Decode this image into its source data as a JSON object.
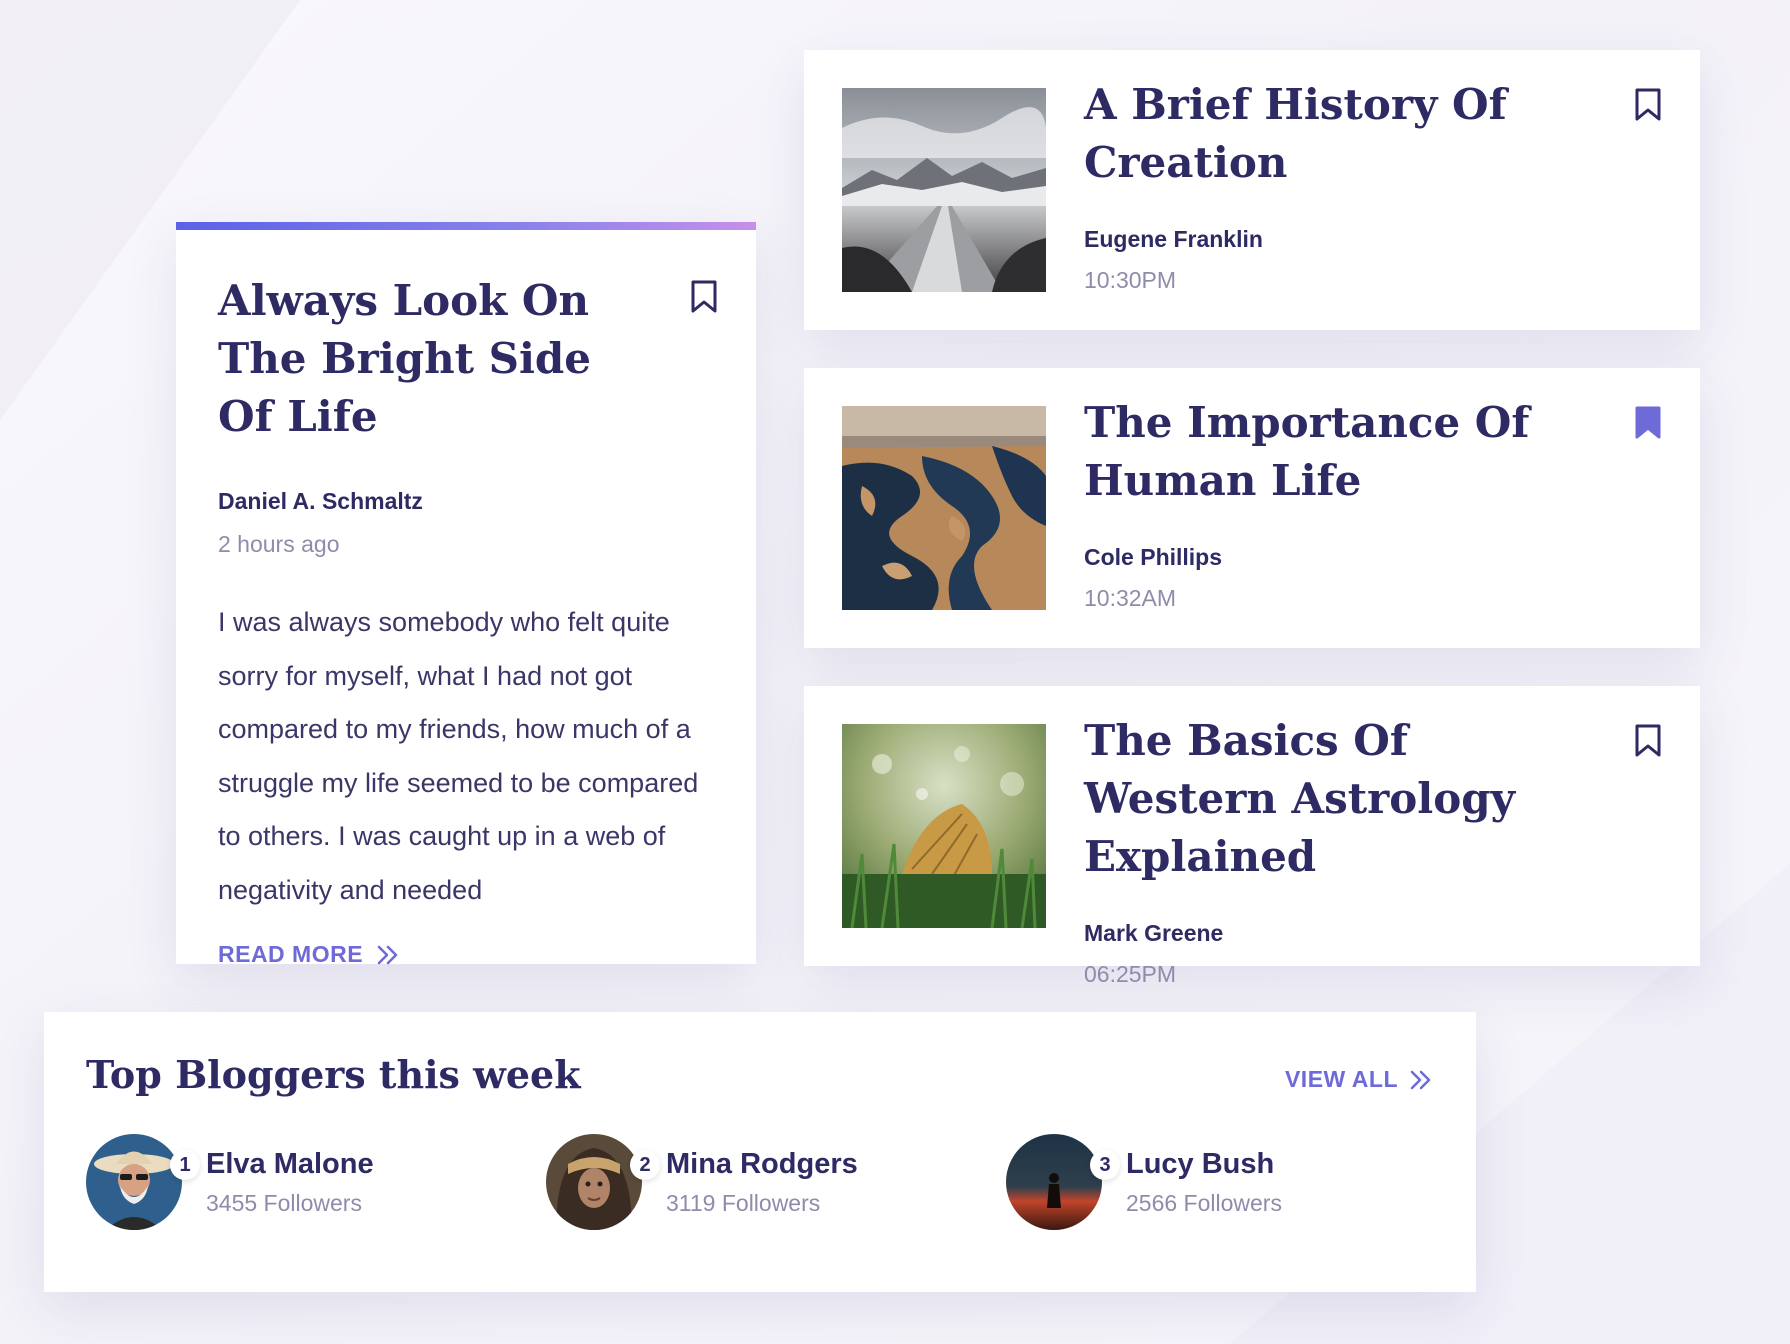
{
  "featured": {
    "title": "Always Look On The Bright Side Of Life",
    "author": "Daniel A. Schmaltz",
    "time": "2 hours ago",
    "excerpt": "I was always somebody who felt quite sorry for myself, what I had not got compared to my friends, how much of a struggle my life seemed to be compared to others. I was caught up in a web of negativity and needed",
    "read_more": "READ MORE",
    "bookmarked": false
  },
  "articles": [
    {
      "title": "A Brief History Of Creation",
      "author": "Eugene Franklin",
      "time": "10:30PM",
      "bookmarked": false,
      "thumb": "snowy-road-image"
    },
    {
      "title": "The Importance Of Human Life",
      "author": "Cole Phillips",
      "time": "10:32AM",
      "bookmarked": true,
      "thumb": "lake-aerial-image"
    },
    {
      "title": "The Basics Of Western Astrology Explained",
      "author": "Mark Greene",
      "time": "06:25PM",
      "bookmarked": false,
      "thumb": "autumn-leaf-image"
    }
  ],
  "bloggers": {
    "title": "Top Bloggers this week",
    "view_all": "VIEW ALL",
    "items": [
      {
        "rank": "1",
        "name": "Elva Malone",
        "followers": "3455 Followers"
      },
      {
        "rank": "2",
        "name": "Mina Rodgers",
        "followers": "3119 Followers"
      },
      {
        "rank": "3",
        "name": "Lucy Bush",
        "followers": "2566 Followers"
      }
    ]
  },
  "colors": {
    "accent": "#6e6ad8",
    "title": "#2d2a64",
    "muted": "#8e8cab"
  }
}
